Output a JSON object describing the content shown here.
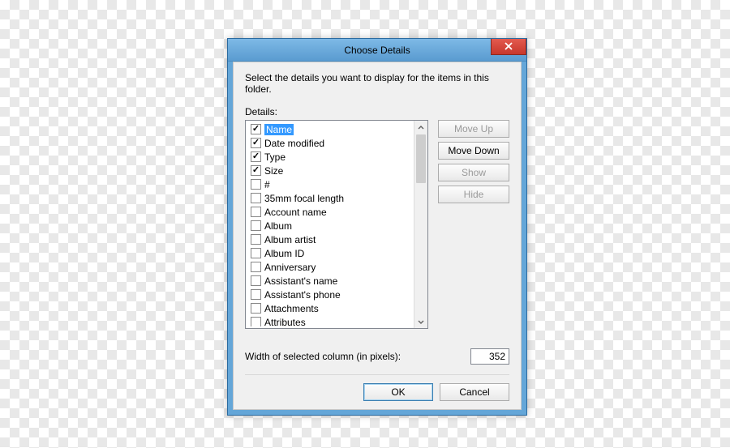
{
  "title": "Choose Details",
  "instruction": "Select the details you want to display for the items in this folder.",
  "details_label": "Details:",
  "items": [
    {
      "label": "Name",
      "checked": true,
      "selected": true
    },
    {
      "label": "Date modified",
      "checked": true,
      "selected": false
    },
    {
      "label": "Type",
      "checked": true,
      "selected": false
    },
    {
      "label": "Size",
      "checked": true,
      "selected": false
    },
    {
      "label": "#",
      "checked": false,
      "selected": false
    },
    {
      "label": "35mm focal length",
      "checked": false,
      "selected": false
    },
    {
      "label": "Account name",
      "checked": false,
      "selected": false
    },
    {
      "label": "Album",
      "checked": false,
      "selected": false
    },
    {
      "label": "Album artist",
      "checked": false,
      "selected": false
    },
    {
      "label": "Album ID",
      "checked": false,
      "selected": false
    },
    {
      "label": "Anniversary",
      "checked": false,
      "selected": false
    },
    {
      "label": "Assistant's name",
      "checked": false,
      "selected": false
    },
    {
      "label": "Assistant's phone",
      "checked": false,
      "selected": false
    },
    {
      "label": "Attachments",
      "checked": false,
      "selected": false
    },
    {
      "label": "Attributes",
      "checked": false,
      "selected": false
    }
  ],
  "buttons": {
    "move_up": "Move Up",
    "move_down": "Move Down",
    "show": "Show",
    "hide": "Hide",
    "ok": "OK",
    "cancel": "Cancel"
  },
  "button_states": {
    "move_up_enabled": false,
    "move_down_enabled": true,
    "show_enabled": false,
    "hide_enabled": false
  },
  "width_label": "Width of selected column (in pixels):",
  "width_value": "352"
}
